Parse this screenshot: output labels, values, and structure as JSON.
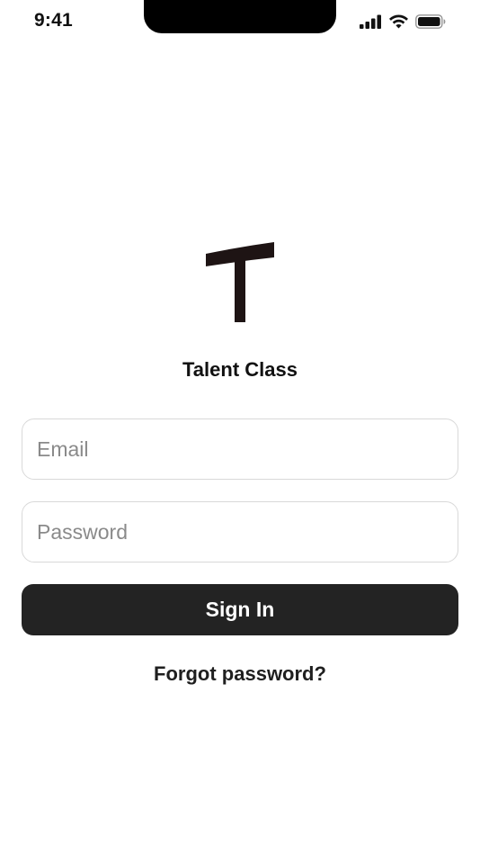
{
  "status_bar": {
    "time": "9:41",
    "icons": [
      "cellular-signal-icon",
      "wifi-icon",
      "battery-icon"
    ]
  },
  "brand": {
    "logo_icon": "talent-class-logo-icon",
    "name": "Talent Class"
  },
  "form": {
    "email": {
      "value": "",
      "placeholder": "Email"
    },
    "password": {
      "value": "",
      "placeholder": "Password"
    },
    "sign_in_label": "Sign In",
    "forgot_label": "Forgot password?"
  },
  "colors": {
    "button_background": "#232323",
    "button_text": "#ffffff",
    "field_border": "#d9d9d9",
    "placeholder": "#8a8a8a",
    "logo": "#1e1414"
  }
}
